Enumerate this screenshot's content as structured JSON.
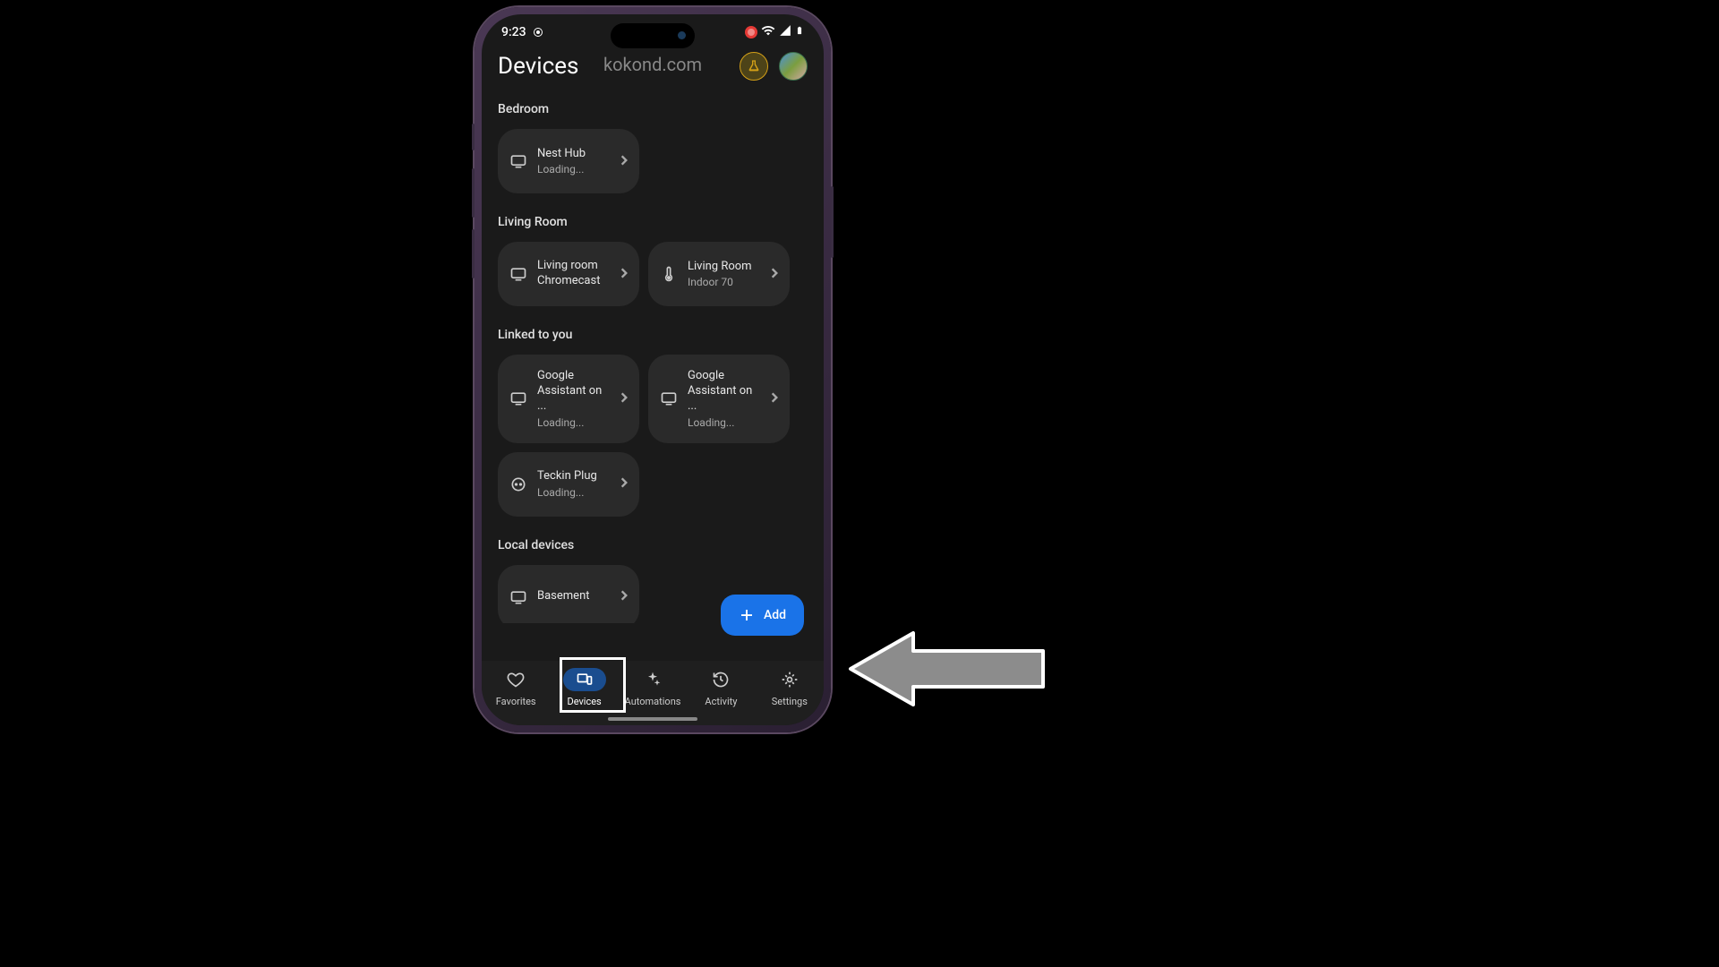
{
  "status": {
    "time": "9:23"
  },
  "watermark": "kokond.com",
  "header": {
    "title": "Devices"
  },
  "sections": [
    {
      "label": "Bedroom",
      "devices": [
        {
          "icon": "tv",
          "title": "Nest Hub",
          "sub": "Loading..."
        }
      ]
    },
    {
      "label": "Living Room",
      "devices": [
        {
          "icon": "tv",
          "title": "Living room Chromecast",
          "sub": ""
        },
        {
          "icon": "thermo",
          "title": "Living Room",
          "sub": "Indoor 70"
        }
      ]
    },
    {
      "label": "Linked to you",
      "devices": [
        {
          "icon": "tv",
          "title": "Google Assistant on ...",
          "sub": "Loading..."
        },
        {
          "icon": "tv",
          "title": "Google Assistant on ...",
          "sub": "Loading..."
        },
        {
          "icon": "plug",
          "title": "Teckin Plug",
          "sub": "Loading..."
        }
      ]
    },
    {
      "label": "Local devices",
      "devices": [
        {
          "icon": "tv",
          "title": "Basement",
          "sub": ""
        }
      ]
    }
  ],
  "fab": {
    "label": "Add"
  },
  "nav": {
    "items": [
      {
        "label": "Favorites",
        "icon": "heart"
      },
      {
        "label": "Devices",
        "icon": "devices",
        "active": true
      },
      {
        "label": "Automations",
        "icon": "sparkle"
      },
      {
        "label": "Activity",
        "icon": "history"
      },
      {
        "label": "Settings",
        "icon": "gear"
      }
    ]
  }
}
